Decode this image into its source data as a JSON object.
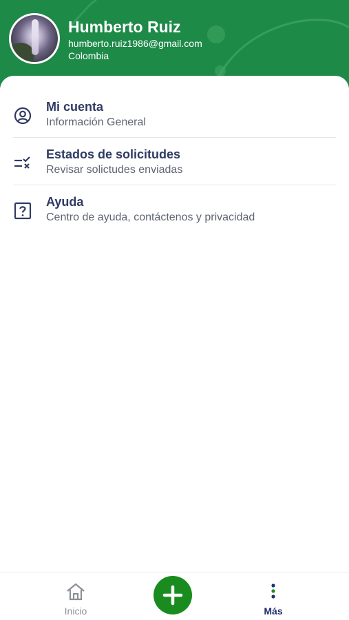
{
  "profile": {
    "name": "Humberto Ruiz",
    "email": "humberto.ruiz1986@gmail.com",
    "country": "Colombia"
  },
  "menu": [
    {
      "title": "Mi cuenta",
      "subtitle": "Información General",
      "icon": "user-circle-icon"
    },
    {
      "title": "Estados de solicitudes",
      "subtitle": "Revisar solictudes enviadas",
      "icon": "checklist-icon"
    },
    {
      "title": "Ayuda",
      "subtitle": "Centro de ayuda, contáctenos y privacidad",
      "icon": "question-box-icon"
    }
  ],
  "tabbar": {
    "home_label": "Inicio",
    "add_icon": "plus-icon",
    "more_label": "Más"
  },
  "colors": {
    "header_green": "#1e8a48",
    "fab_green": "#1a8c1f",
    "title_navy": "#2f3a63",
    "active_tab": "#233072"
  }
}
